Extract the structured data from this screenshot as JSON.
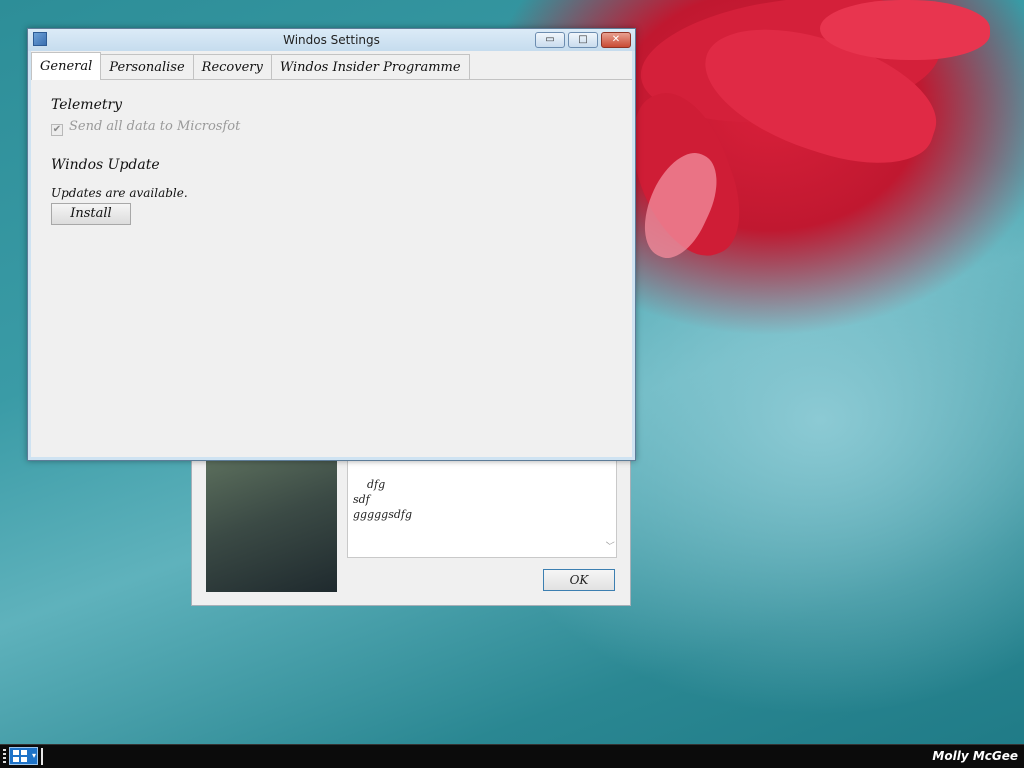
{
  "window": {
    "title": "Windos Settings",
    "controls": {
      "minimize": "▭",
      "maximize": "□",
      "close": "✕"
    }
  },
  "tabs": [
    {
      "label": "General",
      "active": true
    },
    {
      "label": "Personalise",
      "active": false
    },
    {
      "label": "Recovery",
      "active": false
    },
    {
      "label": "Windos Insider Programme",
      "active": false
    }
  ],
  "general": {
    "telemetry_title": "Telemetry",
    "telemetry_checkbox_label": "Send all data to Microsfot",
    "telemetry_checked": true,
    "update_title": "Windos Update",
    "update_status": "Updates are available.",
    "install_label": "Install"
  },
  "back_dialog": {
    "text": "dfg\nsdf\ngggggsdfg",
    "ok_label": "OK"
  },
  "taskbar": {
    "user_name": "Molly McGee"
  },
  "icons": {
    "checkbox_check": "✔",
    "scroll_down": "﹀",
    "start_caret": "▾"
  }
}
